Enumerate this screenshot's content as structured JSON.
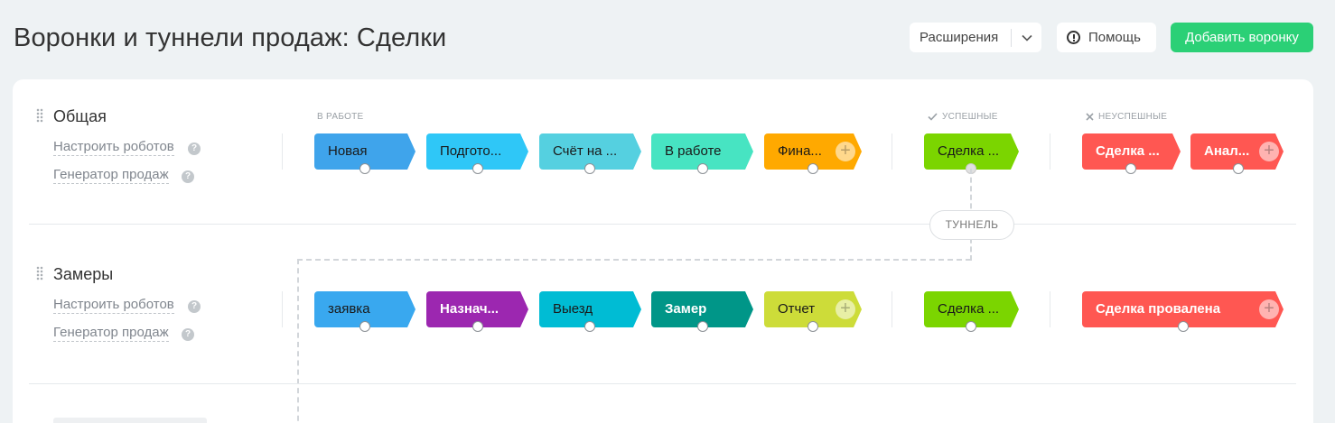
{
  "header": {
    "title": "Воронки и туннели продаж: Сделки",
    "extensions_label": "Расширения",
    "help_label": "Помощь",
    "add_label": "Добавить воронку"
  },
  "groups": {
    "in_work": "В РАБОТЕ",
    "success": "УСПЕШНЫЕ",
    "failure": "НЕУСПЕШНЫЕ"
  },
  "tunnel_label": "ТУННЕЛЬ",
  "pipelines": [
    {
      "name": "Общая",
      "robots_link": "Настроить роботов",
      "generator_link": "Генератор продаж",
      "stages": [
        {
          "label": "Новая",
          "color": "#3fa4eb"
        },
        {
          "label": "Подгото...",
          "color": "#2fc7f7"
        },
        {
          "label": "Счёт на ...",
          "color": "#55d0e0"
        },
        {
          "label": "В работе",
          "color": "#47e4c2"
        },
        {
          "label": "Фина...",
          "color": "#ffa900"
        }
      ],
      "success": [
        {
          "label": "Сделка ...",
          "color": "#7bd500"
        }
      ],
      "failure": [
        {
          "label": "Сделка ...",
          "color": "#ff5752"
        },
        {
          "label": "Анал...",
          "color": "#ff5752"
        }
      ]
    },
    {
      "name": "Замеры",
      "robots_link": "Настроить роботов",
      "generator_link": "Генератор продаж",
      "stages": [
        {
          "label": "заявка",
          "color": "#39a8ef"
        },
        {
          "label": "Назнач...",
          "color": "#9c27b0"
        },
        {
          "label": "Выезд",
          "color": "#00bcd4"
        },
        {
          "label": "Замер",
          "color": "#009688"
        },
        {
          "label": "Отчет",
          "color": "#cddc39"
        }
      ],
      "success": [
        {
          "label": "Сделка ...",
          "color": "#7bd500"
        }
      ],
      "failure": [
        {
          "label": "Сделка провалена",
          "color": "#ff5752"
        }
      ]
    }
  ]
}
